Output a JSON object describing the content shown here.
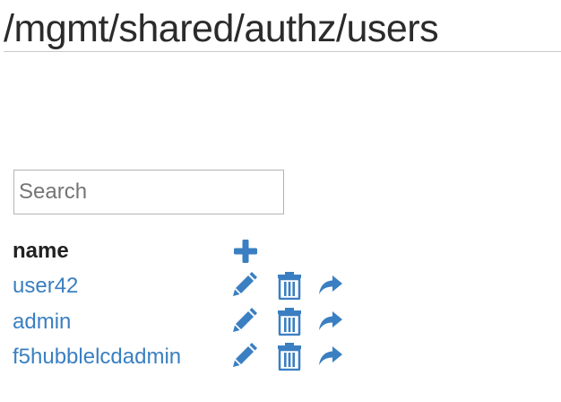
{
  "page": {
    "title": "/mgmt/shared/authz/users"
  },
  "search": {
    "placeholder": "Search",
    "value": ""
  },
  "table": {
    "column_header": "name",
    "add_icon": "plus-icon",
    "action_icons": [
      "pencil-icon",
      "trash-icon",
      "share-arrow-icon"
    ],
    "rows": [
      {
        "name": "user42"
      },
      {
        "name": "admin"
      },
      {
        "name": "f5hubblelcdadmin"
      }
    ]
  },
  "colors": {
    "accent": "#3a7fc1",
    "title": "#2b2b2b"
  }
}
